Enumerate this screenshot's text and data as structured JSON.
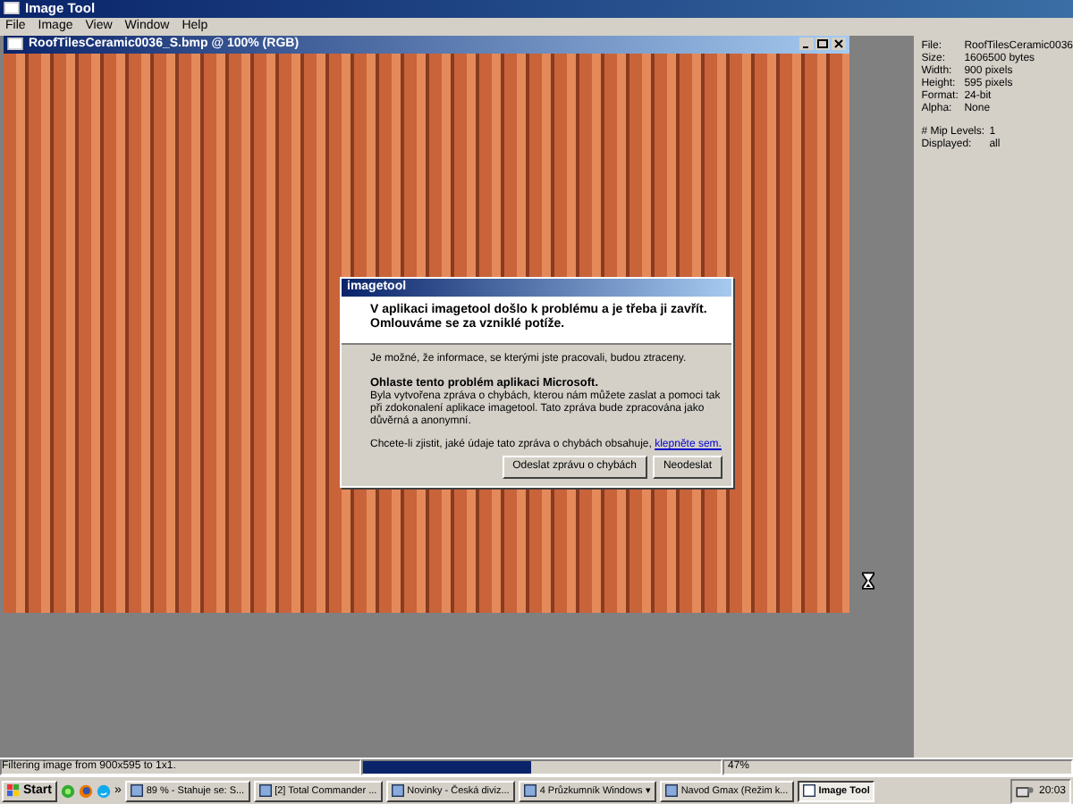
{
  "app_window": {
    "title": "Image Tool"
  },
  "menu": [
    "File",
    "Image",
    "View",
    "Window",
    "Help"
  ],
  "document_window": {
    "title": "RoofTilesCeramic0036_S.bmp @ 100% (RGB)"
  },
  "info_panel": [
    [
      {
        "label": "File:",
        "value": "RoofTilesCeramic0036"
      },
      {
        "label": "Size:",
        "value": "1606500 bytes"
      },
      {
        "label": "Width:",
        "value": "900 pixels"
      },
      {
        "label": "Height:",
        "value": "595 pixels"
      },
      {
        "label": "Format:",
        "value": "24-bit"
      },
      {
        "label": "Alpha:",
        "value": "None"
      }
    ],
    [
      {
        "label": "# Mip Levels:",
        "value": "1"
      },
      {
        "label": "Displayed:",
        "value": "all"
      }
    ]
  ],
  "error_dialog": {
    "title": "imagetool",
    "heading": "V aplikaci imagetool došlo k problému a je třeba ji zavřít. Omlouváme se za vzniklé potíže.",
    "note": "Je možné, že informace, se kterými jste pracovali, budou ztraceny.",
    "report_heading": "Ohlaste tento problém aplikaci Microsoft.",
    "report_text": "Byla vytvořena zpráva o chybách, kterou nám můžete zaslat a pomoci tak při zdokonalení aplikace imagetool. Tato zpráva bude zpracována jako důvěrná a anonymní.",
    "details_text": "Chcete-li zjistit, jaké údaje tato zpráva o chybách obsahuje,",
    "details_link": "klepněte sem.",
    "buttons": [
      "Odeslat zprávu o chybách",
      "Neodeslat"
    ]
  },
  "status_bar": {
    "message": "Filtering image from 900x595 to 1x1.",
    "progress": {
      "level": 0.47
    },
    "percent": "47%"
  },
  "taskbar": {
    "start": "Start",
    "overflow": "»",
    "tasks": [
      {
        "label": "89 % - Stahuje se: S...",
        "selected": false
      },
      {
        "label": "[2] Total Commander ...",
        "selected": false
      },
      {
        "label": "Novinky - Česká diviz...",
        "selected": false
      },
      {
        "label": "4 Průzkumník Windows ▾",
        "selected": false
      },
      {
        "label": "Navod Gmax (Režim k...",
        "selected": false
      },
      {
        "label": "Image Tool",
        "selected": true
      }
    ],
    "clock": "20:03"
  }
}
